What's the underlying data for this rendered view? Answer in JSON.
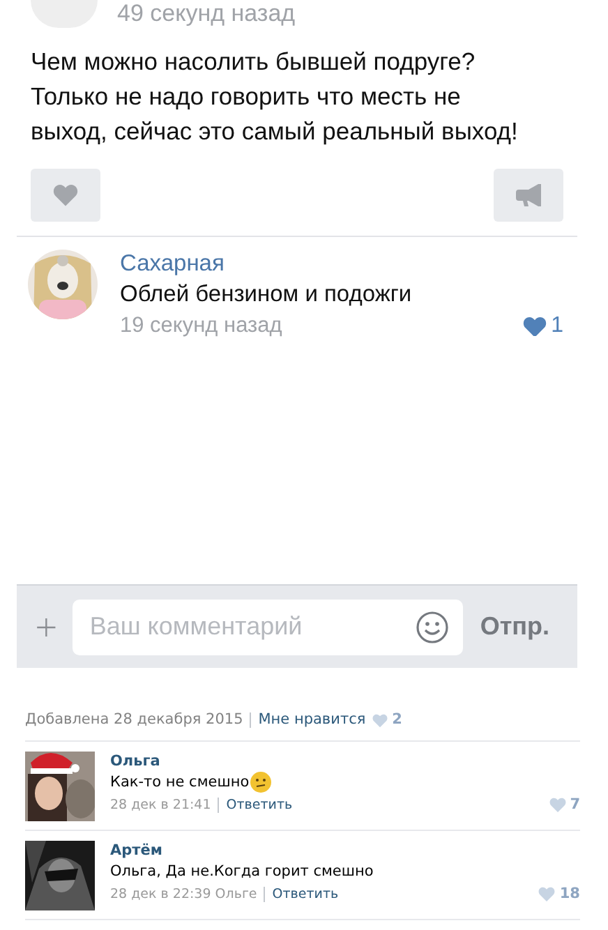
{
  "post": {
    "time": "49 секунд назад",
    "text": "Чем можно насолить бывшей подруге? Только не надо говорить что месть не выход, сейчас это самый реальный выход!"
  },
  "top_comment": {
    "author": "Сахарная",
    "text": "Облей бензином и подожги",
    "time": "19 секунд назад",
    "likes": "1",
    "liked": true
  },
  "composer": {
    "placeholder": "Ваш комментарий",
    "send": "Отпр."
  },
  "footer": {
    "added": "Добавлена 28 декабря 2015",
    "like_link": "Мне нравится",
    "likes": "2",
    "liked": false
  },
  "comments": [
    {
      "author": "Ольга",
      "text": "Как-то не смешно",
      "emoji": true,
      "time": "28 дек в 21:41",
      "reply": "Ответить",
      "likes": "7",
      "liked": false
    },
    {
      "author": "Артём",
      "text": "Ольга, Да не.Когда горит смешно",
      "emoji": false,
      "time": "28 дек в 22:39 Ольге",
      "reply": "Ответить",
      "likes": "18",
      "liked": false
    }
  ]
}
